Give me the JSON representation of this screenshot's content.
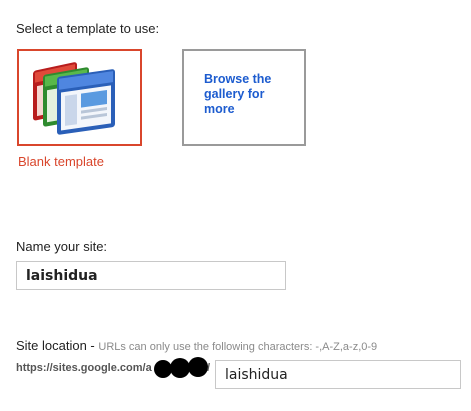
{
  "template_section": {
    "heading": "Select a template to use:",
    "blank_label": "Blank template",
    "browse_label": "Browse the gallery for more"
  },
  "name_section": {
    "label": "Name your site:",
    "value": "laishidua"
  },
  "location_section": {
    "label": "Site location - ",
    "hint": "URLs can only use the following characters: -,A-Z,a-z,0-9",
    "url_prefix": "https://sites.google.com/a",
    "url_suffix": "/",
    "value": "laishidua"
  },
  "colors": {
    "selected_border": "#d9462c",
    "link_blue": "#1d5ccf",
    "unselected_border": "#9a9a9a"
  }
}
